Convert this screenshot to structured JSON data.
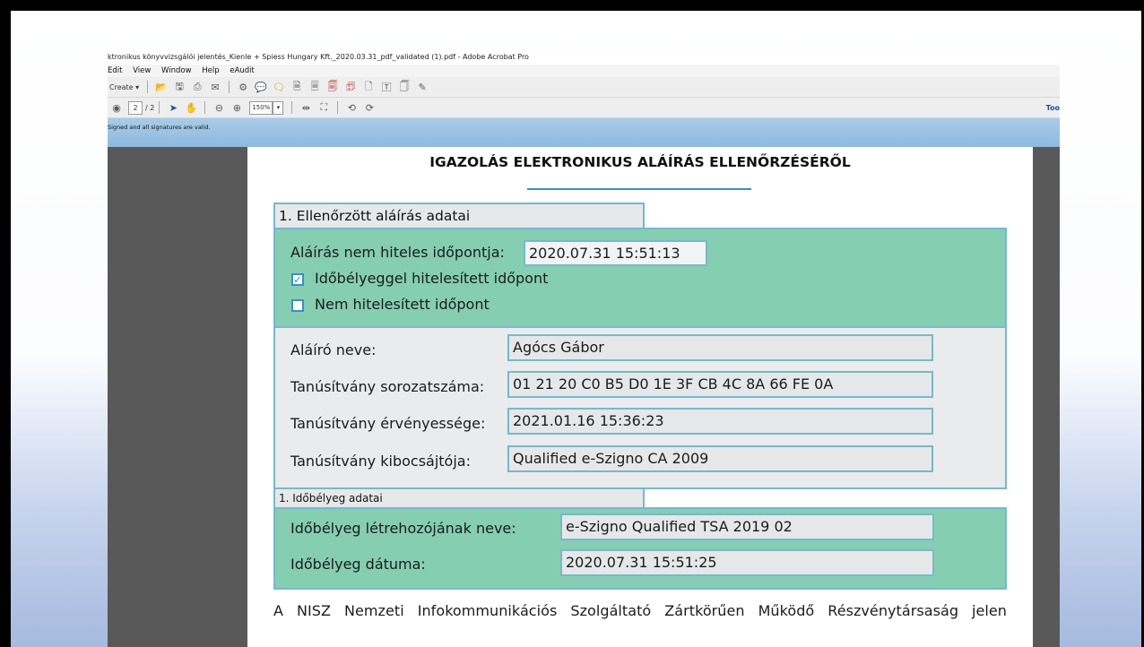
{
  "window": {
    "title": "ktronikus könyvvizsgálói jelentés_Kienle + Spiess Hungary Kft._2020.03.31_pdf_validated (1).pdf - Adobe Acrobat Pro"
  },
  "menu": [
    "Edit",
    "View",
    "Window",
    "Help",
    "eAudit"
  ],
  "toolbar": {
    "create_label": "Create ▾",
    "page_current": "2",
    "page_total": "/ 2",
    "zoom_value": "150%",
    "tools_label": "Too"
  },
  "signature_bar": {
    "message": "Signed and all signatures are valid."
  },
  "document": {
    "title": "IGAZOLÁS ELEKTRONIKUS ALÁÍRÁS ELLENŐRZÉSÉRŐL",
    "section1": {
      "heading": "1. Ellenőrzött aláírás adatai",
      "signing_time_label": "Aláírás nem hiteles időpontja:",
      "signing_time_value": "2020.07.31 15:51:13",
      "checkbox_timestamped": {
        "label": "Időbélyeggel hitelesített időpont",
        "checked": true
      },
      "checkbox_not_authenticated": {
        "label": "Nem hitelesített időpont",
        "checked": false
      },
      "signer_name_label": "Aláíró neve:",
      "signer_name_value": "Agócs Gábor",
      "cert_serial_label": "Tanúsítvány sorozatszáma:",
      "cert_serial_value": "01 21 20 C0 B5 D0 1E 3F CB 4C 8A 66 FE 0A",
      "cert_validity_label": "Tanúsítvány érvényessége:",
      "cert_validity_value": "2021.01.16 15:36:23",
      "cert_issuer_label": "Tanúsítvány kibocsájtója:",
      "cert_issuer_value": "Qualified e-Szigno CA 2009"
    },
    "section2": {
      "heading": "1. Időbélyeg adatai",
      "tsa_name_label": "Időbélyeg létrehozójának neve:",
      "tsa_name_value": "e-Szigno Qualified TSA 2019 02",
      "tsa_date_label": "Időbélyeg dátuma:",
      "tsa_date_value": "2020.07.31 15:51:25"
    },
    "paragraph": "A NISZ Nemzeti Infokommunikációs Szolgáltató Zártkörűen Működő Részvénytársaság jelen"
  },
  "colors": {
    "section_green": "#85ceb2",
    "section_border": "#78b8cc",
    "signature_bar": "#a8cce8",
    "viewer_background": "#595959"
  }
}
